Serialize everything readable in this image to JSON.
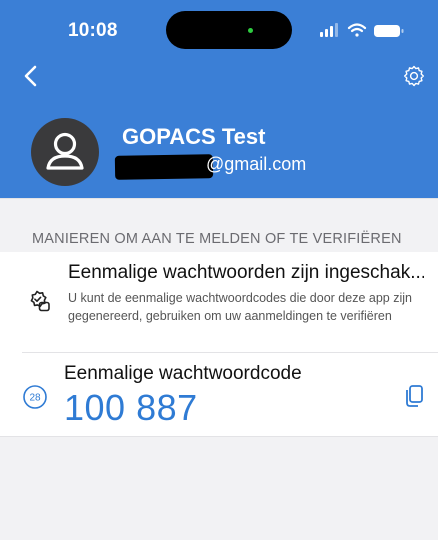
{
  "status_bar": {
    "time": "10:08"
  },
  "account": {
    "name": "GOPACS Test",
    "email_visible": "@gmail.com"
  },
  "section": {
    "title": "MANIEREN OM AAN TE MELDEN OF TE VERIFIËREN"
  },
  "otp_setting": {
    "title": "Eenmalige wachtwoorden zijn ingeschak...",
    "description": "U kunt de eenmalige wachtwoordcodes die door deze app zijn gegenereerd, gebruiken om uw aanmeldingen te verifiëren"
  },
  "code": {
    "label": "Eenmalige wachtwoordcode",
    "value": "100 887",
    "timer_seconds": "28"
  },
  "colors": {
    "header_bg": "#3b7fd6",
    "accent": "#2f7bd4"
  }
}
